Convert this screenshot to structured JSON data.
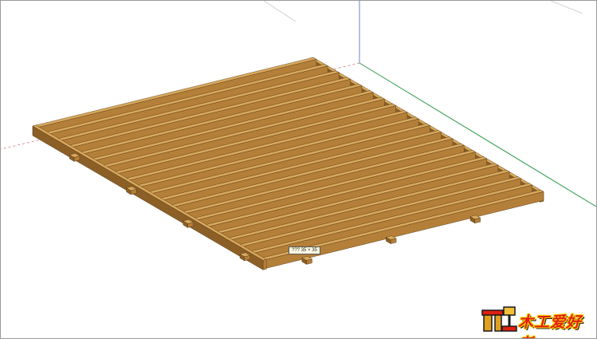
{
  "model_viewport": {
    "object": "wooden floor joist frame",
    "axis_colors": {
      "red": "#c85a5a",
      "green": "#2f9a4a",
      "blue": "#6a7fd0"
    },
    "wood_colors": {
      "top": "#d9a85c",
      "side_light": "#b47f38",
      "side_dark": "#8c5f26",
      "edge": "#4a3212"
    },
    "tooltip_text": "??? 35 × 35"
  },
  "watermark": {
    "logo_text": "木工爱好者",
    "icon": "carpenter-logo-icon",
    "colors": {
      "fill": "#e01f0f",
      "outline": "#ffd400",
      "shadow": "#1a1a1a"
    }
  }
}
